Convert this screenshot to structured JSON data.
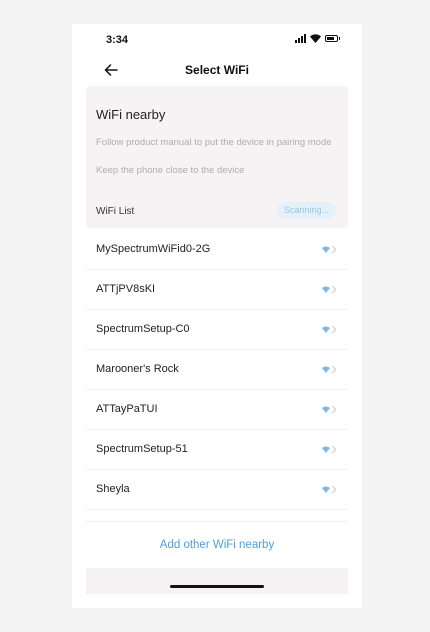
{
  "status_bar": {
    "time": "3:34"
  },
  "nav": {
    "title": "Select WiFi"
  },
  "info": {
    "title": "WiFi nearby",
    "instruction_1": "Follow product manual to put the device in pairing mode",
    "instruction_2": "Keep the phone close to the device",
    "list_label": "WiFi List",
    "scanning_label": "Scanning..."
  },
  "networks": [
    {
      "name": "MySpectrumWiFid0-2G"
    },
    {
      "name": "ATTjPV8sKI"
    },
    {
      "name": "SpectrumSetup-C0"
    },
    {
      "name": "Marooner's Rock"
    },
    {
      "name": "ATTayPaTUI"
    },
    {
      "name": "SpectrumSetup-51"
    },
    {
      "name": "Sheyla"
    }
  ],
  "add_other_label": "Add other WiFi nearby",
  "colors": {
    "accent": "#4b9fe0",
    "wifi_icon": "#7fb6e6",
    "card_bg": "#f5f3f3"
  },
  "icons": {
    "back": "arrow-left-icon",
    "signal": "wifi-signal-icon",
    "chevron": "chevron-right-icon"
  }
}
